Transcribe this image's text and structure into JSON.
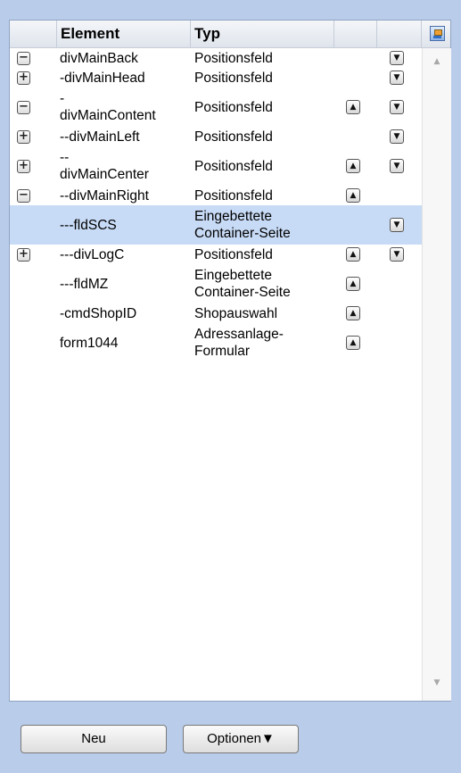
{
  "header": {
    "element_col": "Element",
    "typ_col": "Typ",
    "icon": "layout-icon"
  },
  "rows": [
    {
      "toggle": "−",
      "element": "divMainBack",
      "typ": "Positionsfeld",
      "up": "",
      "down": "▼"
    },
    {
      "toggle": "+",
      "element": "-divMainHead",
      "typ": "Positionsfeld",
      "up": "",
      "down": "▼"
    },
    {
      "toggle": "−",
      "element_line1": "-",
      "element": "divMainContent",
      "typ": "Positionsfeld",
      "up": "▲",
      "down": "▼"
    },
    {
      "toggle": "+",
      "element": "--divMainLeft",
      "typ": "Positionsfeld",
      "up": "",
      "down": "▼"
    },
    {
      "toggle": "+",
      "element_line1": "--",
      "element": "divMainCenter",
      "typ": "Positionsfeld",
      "up": "▲",
      "down": "▼"
    },
    {
      "toggle": "−",
      "element": "--divMainRight",
      "typ": "Positionsfeld",
      "up": "▲",
      "down": ""
    },
    {
      "toggle": "",
      "element": "---fldSCS",
      "typ_line1": "Eingebettete",
      "typ": "Container-Seite",
      "up": "",
      "down": "▼",
      "selected": true
    },
    {
      "toggle": "+",
      "element": "---divLogC",
      "typ": "Positionsfeld",
      "up": "▲",
      "down": "▼"
    },
    {
      "toggle": "",
      "element": "---fldMZ",
      "typ_line1": "Eingebettete",
      "typ": "Container-Seite",
      "up": "▲",
      "down": ""
    },
    {
      "toggle": "",
      "element": "-cmdShopID",
      "typ": "Shopauswahl",
      "up": "▲",
      "down": ""
    },
    {
      "toggle": "",
      "element": "form1044",
      "typ_line1": "Adressanlage-",
      "typ": "Formular",
      "up": "▲",
      "down": ""
    }
  ],
  "scrollbar": {
    "up": "▲",
    "down": "▼"
  },
  "buttons": {
    "new_label": "Neu",
    "options_label": "Optionen▼"
  }
}
